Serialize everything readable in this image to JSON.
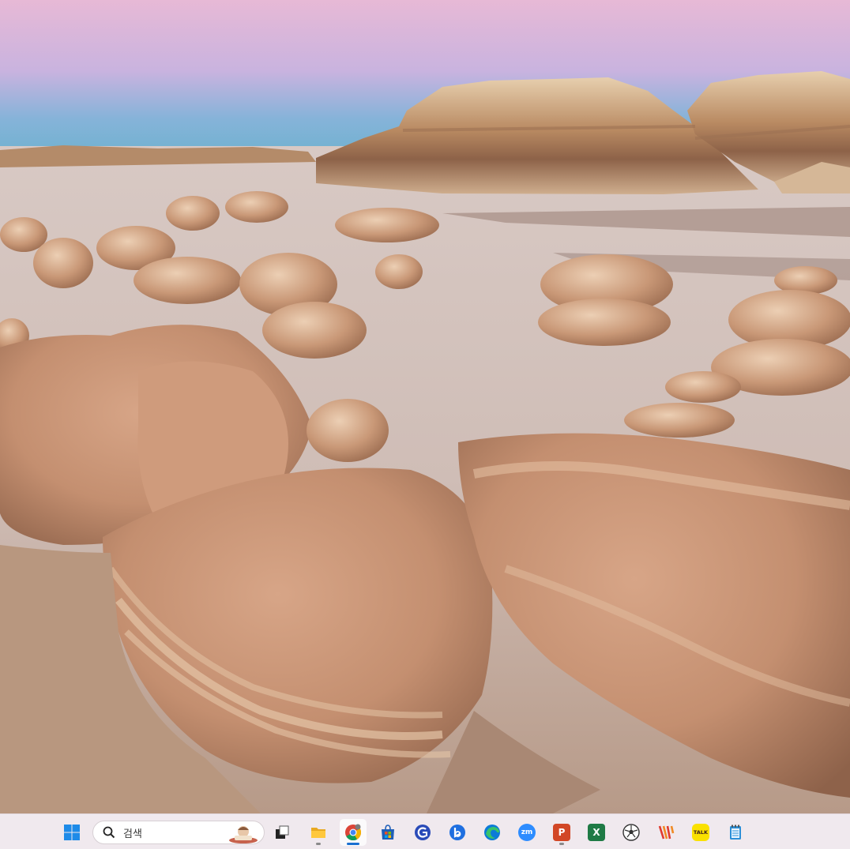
{
  "taskbar": {
    "search": {
      "placeholder": "검색"
    },
    "apps": [
      {
        "name": "task-view",
        "label": ""
      },
      {
        "name": "file-explorer",
        "label": ""
      },
      {
        "name": "chrome",
        "label": ""
      },
      {
        "name": "microsoft-store",
        "label": ""
      },
      {
        "name": "gemini",
        "label": ""
      },
      {
        "name": "bing",
        "label": ""
      },
      {
        "name": "edge",
        "label": ""
      },
      {
        "name": "zoom",
        "label": "zm"
      },
      {
        "name": "powerpoint",
        "label": "P"
      },
      {
        "name": "excel",
        "label": "X"
      },
      {
        "name": "soccer",
        "label": ""
      },
      {
        "name": "winamp-style",
        "label": ""
      },
      {
        "name": "kakaotalk",
        "label": "TALK"
      },
      {
        "name": "notepad",
        "label": ""
      }
    ],
    "active_app": "chrome",
    "colors": {
      "accent": "#1a6fd1",
      "start_blue": "#1e8be8",
      "zoom": "#2d8cff",
      "powerpoint": "#d24726",
      "excel": "#1f7a45",
      "kakao": "#fae100"
    }
  }
}
